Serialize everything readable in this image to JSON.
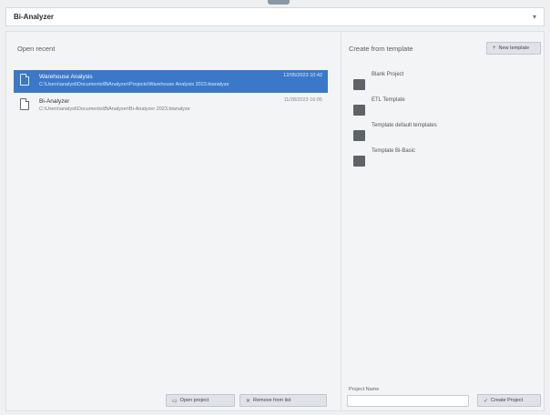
{
  "titlebar": {
    "title": "Bi-Analyzer",
    "chevron": "▾"
  },
  "open_recent": {
    "heading": "Open recent",
    "items": [
      {
        "name": "Warehouse Analysis",
        "path": "C:\\Users\\analyst\\Documents\\BiAnalyzer\\Projects\\Warehouse Analysis 2023.bianalyze",
        "date": "12/05/2023 10:42",
        "selected": true
      },
      {
        "name": "Bi-Analyzer",
        "path": "C:\\Users\\analyst\\Documents\\BiAnalyzer\\Bi-Analyzer 2023.bianalyze",
        "date": "11/28/2023 16:05",
        "selected": false
      }
    ],
    "open_button": "Open project",
    "remove_button": "Remove from list"
  },
  "create_template": {
    "heading": "Create from template",
    "new_button": "New template",
    "templates": [
      {
        "label": "Blank Project",
        "icon": "template-icon"
      },
      {
        "label": "ETL Template",
        "icon": "template-icon"
      },
      {
        "label": "Template default templates",
        "icon": "template-icon"
      },
      {
        "label": "Template Bi-Basic",
        "icon": "template-icon"
      }
    ],
    "project_name_label": "Project Name",
    "project_name_value": "",
    "create_button": "Create Project"
  },
  "colors": {
    "accent": "#3b78c9",
    "background": "#eef0f2"
  }
}
